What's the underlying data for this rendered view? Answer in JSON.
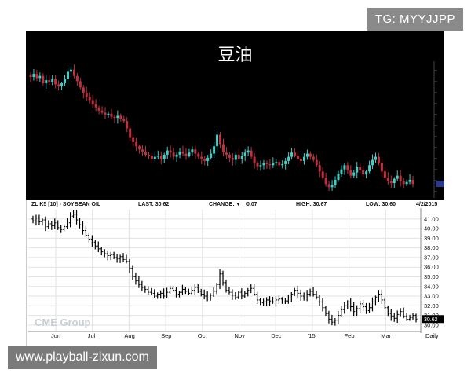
{
  "header": {
    "tg_label": "TG: MYYJJPP"
  },
  "footer": {
    "website": "www.playball-zixun.com"
  },
  "chart_data": [
    {
      "type": "candlestick",
      "title": "豆油",
      "background": "#000000",
      "up_color": "#3fd0c8",
      "down_color": "#c03040",
      "close": [
        40.8,
        41.1,
        40.7,
        40.9,
        40.2,
        40.5,
        40.3,
        40.6,
        40.1,
        39.9,
        40.2,
        40.6,
        41.3,
        41.5,
        40.9,
        40.4,
        39.8,
        39.3,
        38.9,
        38.6,
        38.2,
        37.9,
        37.6,
        37.4,
        37.2,
        37.3,
        37.0,
        36.9,
        37.1,
        36.8,
        36.6,
        35.9,
        35.0,
        34.6,
        34.2,
        33.9,
        33.7,
        33.4,
        33.3,
        33.0,
        33.2,
        33.3,
        33.0,
        33.4,
        33.8,
        33.6,
        33.2,
        33.4,
        33.7,
        33.5,
        33.3,
        33.6,
        33.9,
        33.5,
        33.2,
        33.0,
        32.8,
        33.1,
        33.5,
        34.2,
        35.3,
        34.4,
        33.6,
        33.4,
        33.1,
        32.9,
        33.4,
        33.0,
        33.3,
        33.6,
        33.8,
        33.2,
        32.6,
        32.3,
        32.4,
        32.6,
        32.5,
        32.4,
        32.6,
        32.7,
        32.4,
        32.5,
        32.8,
        33.2,
        33.6,
        33.3,
        33.0,
        32.8,
        33.2,
        33.5,
        33.2,
        32.9,
        32.4,
        31.8,
        31.2,
        30.6,
        30.3,
        30.5,
        31.0,
        31.6,
        32.0,
        32.4,
        31.9,
        31.4,
        31.7,
        32.2,
        31.9,
        31.5,
        31.8,
        32.4,
        32.9,
        33.2,
        32.6,
        31.8,
        31.2,
        30.9,
        30.7,
        31.1,
        31.4,
        30.9,
        30.6,
        30.8,
        31.0,
        30.62
      ],
      "last_price_label": "30.62"
    },
    {
      "type": "ohlc",
      "title": "ZL K5 [10] - SOYBEAN OIL",
      "stats": {
        "last_label": "LAST: 30.62",
        "change_label": "CHANGE:",
        "change_arrow": "▼",
        "change_value": "0.07",
        "high_label": "HIGH: 30.67",
        "low_label": "LOW: 30.60",
        "date": "4/2/2015"
      },
      "y_ticks": [
        "41.00",
        "40.00",
        "39.00",
        "38.00",
        "37.00",
        "36.00",
        "35.00",
        "34.00",
        "33.00",
        "32.00",
        "31.00",
        "30.00"
      ],
      "y_range": [
        29.5,
        41.8
      ],
      "x_labels": [
        "Jun",
        "Jul",
        "Aug",
        "Sep",
        "Oct",
        "Nov",
        "Dec",
        "'15",
        "Feb",
        "Mar",
        "Daily"
      ],
      "last_value": 30.62,
      "last_price_label": "30.62",
      "watermark": "CME Group",
      "close": [
        40.8,
        41.1,
        40.7,
        40.9,
        40.2,
        40.5,
        40.3,
        40.6,
        40.1,
        39.9,
        40.2,
        40.6,
        41.3,
        41.5,
        40.9,
        40.4,
        39.8,
        39.3,
        38.9,
        38.6,
        38.2,
        37.9,
        37.6,
        37.4,
        37.2,
        37.3,
        37.0,
        36.9,
        37.1,
        36.8,
        36.6,
        35.9,
        35.0,
        34.6,
        34.2,
        33.9,
        33.7,
        33.4,
        33.3,
        33.0,
        33.2,
        33.3,
        33.0,
        33.4,
        33.8,
        33.6,
        33.2,
        33.4,
        33.7,
        33.5,
        33.3,
        33.6,
        33.9,
        33.5,
        33.2,
        33.0,
        32.8,
        33.1,
        33.5,
        34.2,
        35.3,
        34.4,
        33.6,
        33.4,
        33.1,
        32.9,
        33.4,
        33.0,
        33.3,
        33.6,
        33.8,
        33.2,
        32.6,
        32.3,
        32.4,
        32.6,
        32.5,
        32.4,
        32.6,
        32.7,
        32.4,
        32.5,
        32.8,
        33.2,
        33.6,
        33.3,
        33.0,
        32.8,
        33.2,
        33.5,
        33.2,
        32.9,
        32.4,
        31.8,
        31.2,
        30.6,
        30.3,
        30.5,
        31.0,
        31.6,
        32.0,
        32.4,
        31.9,
        31.4,
        31.7,
        32.2,
        31.9,
        31.5,
        31.8,
        32.4,
        32.9,
        33.2,
        32.6,
        31.8,
        31.2,
        30.9,
        30.7,
        31.1,
        31.4,
        30.9,
        30.6,
        30.8,
        31.0,
        30.62
      ]
    }
  ]
}
